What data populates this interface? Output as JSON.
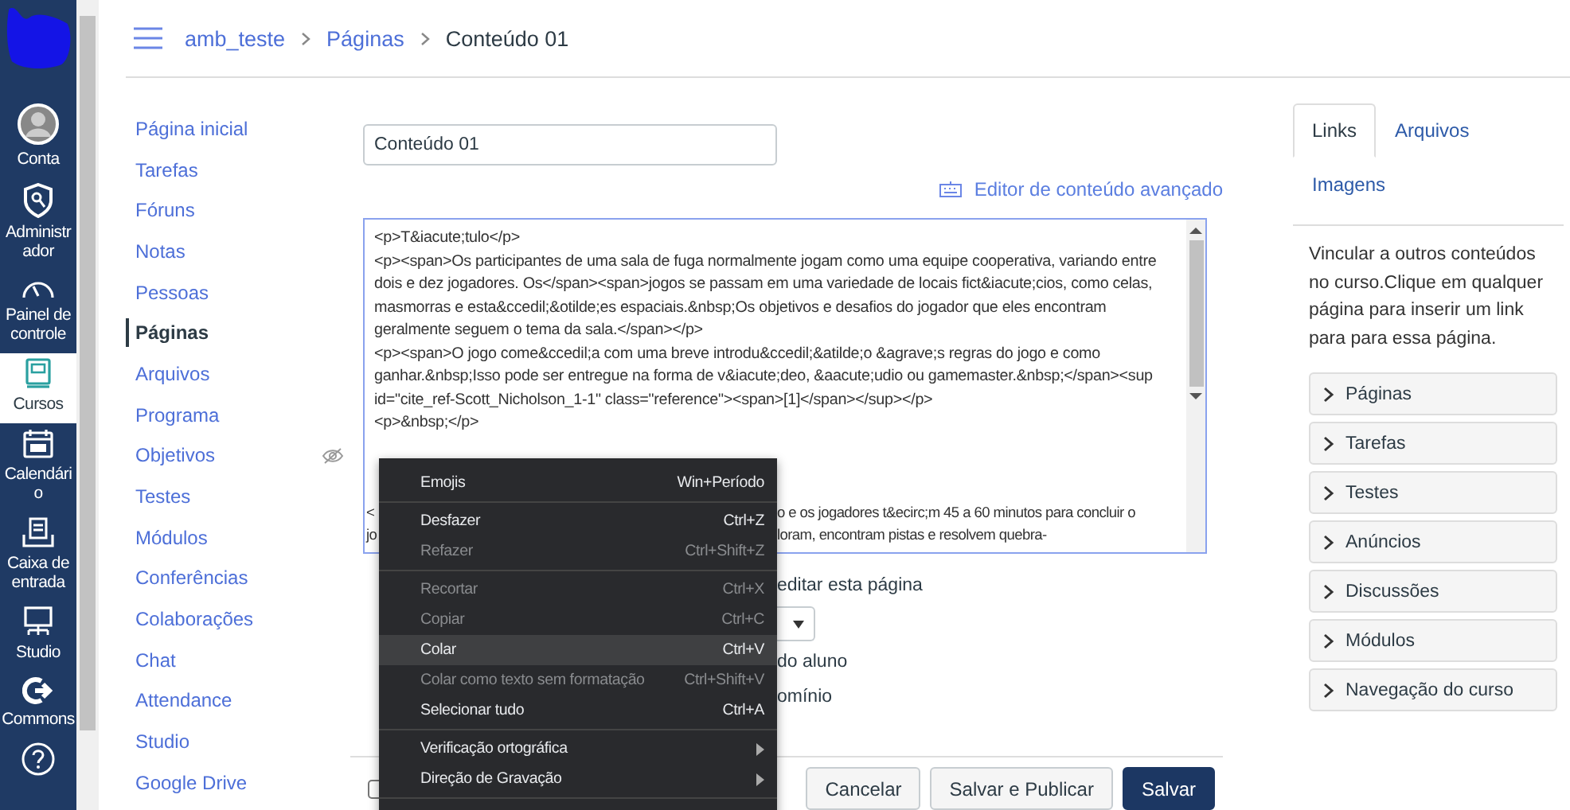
{
  "global_nav": [
    {
      "kind": "account",
      "label": "Conta",
      "selected": false
    },
    {
      "kind": "admin",
      "label": "Administrador",
      "selected": false
    },
    {
      "kind": "dashboard",
      "label": "Painel de controle",
      "selected": false
    },
    {
      "kind": "courses",
      "label": "Cursos",
      "selected": true
    },
    {
      "kind": "calendar",
      "label": "Calendário",
      "selected": false
    },
    {
      "kind": "inbox",
      "label": "Caixa de entrada",
      "selected": false
    },
    {
      "kind": "studio",
      "label": "Studio",
      "selected": false
    },
    {
      "kind": "commons",
      "label": "Commons",
      "selected": false
    },
    {
      "kind": "help",
      "selected": false
    }
  ],
  "breadcrumb": [
    {
      "label": "amb_teste"
    },
    {
      "label": "Páginas"
    },
    {
      "label": "Conteúdo 01"
    }
  ],
  "course_nav": [
    {
      "label": "Página inicial",
      "selected": false,
      "hidden": false
    },
    {
      "label": "Tarefas",
      "selected": false,
      "hidden": false
    },
    {
      "label": "Fóruns",
      "selected": false,
      "hidden": false
    },
    {
      "label": "Notas",
      "selected": false,
      "hidden": false
    },
    {
      "label": "Pessoas",
      "selected": false,
      "hidden": false
    },
    {
      "label": "Páginas",
      "selected": true,
      "hidden": false
    },
    {
      "label": "Arquivos",
      "selected": false,
      "hidden": false
    },
    {
      "label": "Programa",
      "selected": false,
      "hidden": false
    },
    {
      "label": "Objetivos",
      "selected": false,
      "hidden": true
    },
    {
      "label": "Testes",
      "selected": false,
      "hidden": false
    },
    {
      "label": "Módulos",
      "selected": false,
      "hidden": false
    },
    {
      "label": "Conferências",
      "selected": false,
      "hidden": false
    },
    {
      "label": "Colaborações",
      "selected": false,
      "hidden": false
    },
    {
      "label": "Chat",
      "selected": false,
      "hidden": false
    },
    {
      "label": "Attendance",
      "selected": false,
      "hidden": false
    },
    {
      "label": "Studio",
      "selected": false,
      "hidden": false
    },
    {
      "label": "Google Drive",
      "selected": false,
      "hidden": false
    }
  ],
  "title_field": {
    "value": "Conteúdo 01"
  },
  "editor_link": "Editor de conteúdo avançado",
  "editor": {
    "lines": [
      "<p>T&iacute;tulo</p>",
      "<p><span>Os participantes de uma sala de fuga normalmente jogam como uma equipe cooperativa, variando entre dois e dez jogadores. Os</span><span>jogos se passam em uma variedade de locais fict&iacute;cios, como celas, masmorras e esta&ccedil;&otilde;es espaciais.&nbsp;Os objetivos e desafios do jogador que eles encontram geralmente seguem o tema da sala.</span></p>",
      "<p><span>O jogo come&ccedil;a com uma breve introdu&ccedil;&atilde;o &agrave;s regras do jogo e como ganhar.&nbsp;Isso pode ser entregue na forma de v&iacute;deo, &aacute;udio ou gamemaster.&nbsp;</span><sup id=\"cite_ref-Scott_Nicholson_1-1\" class=\"reference\"><span>[1]</span></sup></p>",
      "<p>&nbsp;</p>"
    ],
    "partial_lines": [
      {
        "left": "<",
        "right": "o e os jogadores t&ecirc;m 45 a 60 minutos para concluir o"
      },
      {
        "left": "jo",
        "right": "loram, encontram pistas e resolvem quebra-"
      }
    ]
  },
  "options": [
    {
      "kind": "text",
      "text": "editar esta página"
    },
    {
      "kind": "select"
    },
    {
      "kind": "text",
      "text": "do aluno"
    },
    {
      "kind": "text",
      "text": "omínio"
    }
  ],
  "context_menu": [
    [
      {
        "label": "Emojis",
        "shortcut": "Win+Período",
        "disabled": false,
        "selected": false,
        "submenu": false
      }
    ],
    [
      {
        "label": "Desfazer",
        "shortcut": "Ctrl+Z",
        "disabled": false,
        "selected": false,
        "submenu": false
      },
      {
        "label": "Refazer",
        "shortcut": "Ctrl+Shift+Z",
        "disabled": true,
        "selected": false,
        "submenu": false
      }
    ],
    [
      {
        "label": "Recortar",
        "shortcut": "Ctrl+X",
        "disabled": true,
        "selected": false,
        "submenu": false
      },
      {
        "label": "Copiar",
        "shortcut": "Ctrl+C",
        "disabled": true,
        "selected": false,
        "submenu": false
      },
      {
        "label": "Colar",
        "shortcut": "Ctrl+V",
        "disabled": false,
        "selected": true,
        "submenu": false
      },
      {
        "label": "Colar como texto sem formatação",
        "shortcut": "Ctrl+Shift+V",
        "disabled": true,
        "selected": false,
        "submenu": false
      },
      {
        "label": "Selecionar tudo",
        "shortcut": "Ctrl+A",
        "disabled": false,
        "selected": false,
        "submenu": false
      }
    ],
    [
      {
        "label": "Verificação ortográfica",
        "disabled": false,
        "selected": false,
        "submenu": true
      },
      {
        "label": "Direção de Gravação",
        "disabled": false,
        "selected": false,
        "submenu": true
      }
    ]
  ],
  "footer": {
    "notify_checked": false,
    "buttons": [
      {
        "label": "Cancelar",
        "primary": false
      },
      {
        "label": "Salvar e Publicar",
        "primary": false
      },
      {
        "label": "Salvar",
        "primary": true
      }
    ]
  },
  "sidebar": {
    "tabs": [
      {
        "label": "Links",
        "selected": true
      },
      {
        "label": "Arquivos",
        "selected": false
      },
      {
        "label": "Imagens",
        "selected": false
      }
    ],
    "description": "Vincular a outros conteúdos no curso.Clique em qualquer página para inserir um link para para essa página.",
    "sections": [
      {
        "label": "Páginas",
        "expanded": false
      },
      {
        "label": "Tarefas",
        "expanded": false
      },
      {
        "label": "Testes",
        "expanded": false
      },
      {
        "label": "Anúncios",
        "expanded": false
      },
      {
        "label": "Discussões",
        "expanded": false
      },
      {
        "label": "Módulos",
        "expanded": false
      },
      {
        "label": "Navegação do curso",
        "expanded": false
      }
    ]
  }
}
